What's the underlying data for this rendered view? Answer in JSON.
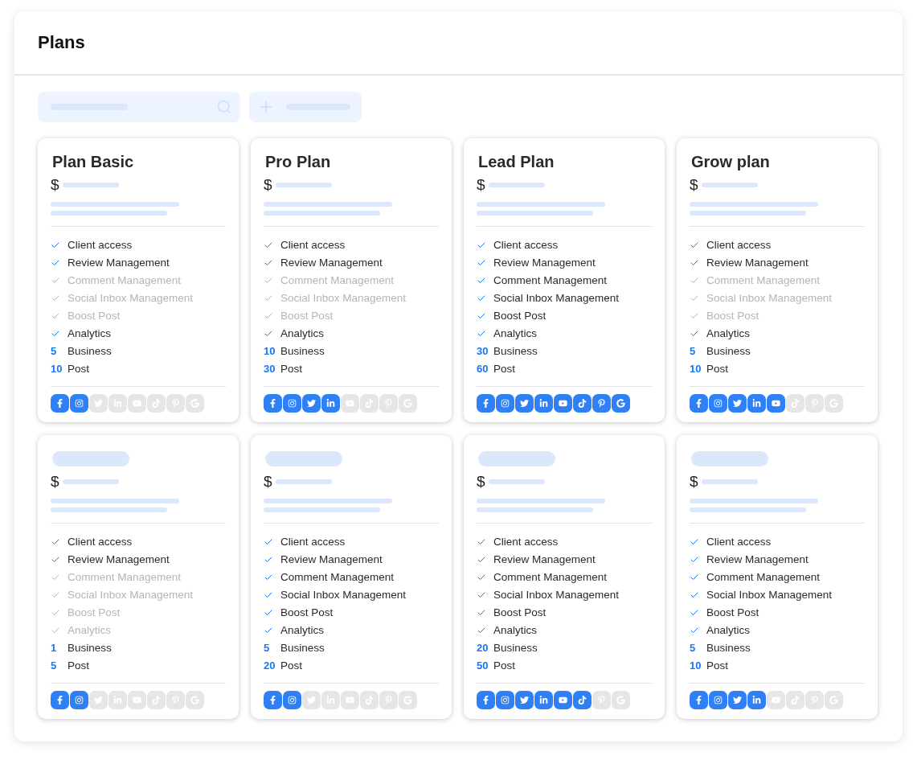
{
  "page": {
    "title": "Plans"
  },
  "cards": [
    {
      "title": "Plan Basic",
      "features": [
        {
          "kind": "check",
          "label": "Client access",
          "checked": true
        },
        {
          "kind": "check",
          "label": "Review Management",
          "checked": true
        },
        {
          "kind": "check",
          "label": "Comment Management",
          "checked": false
        },
        {
          "kind": "check",
          "label": "Social Inbox Management",
          "checked": false
        },
        {
          "kind": "check",
          "label": "Boost Post",
          "checked": false
        },
        {
          "kind": "check",
          "label": "Analytics",
          "checked": true
        },
        {
          "kind": "count",
          "amount": "5",
          "label": "Business"
        },
        {
          "kind": "count",
          "amount": "10",
          "label": "Post"
        }
      ],
      "socials": [
        {
          "kind": "facebook",
          "on": true
        },
        {
          "kind": "instagram",
          "on": true
        },
        {
          "kind": "twitter",
          "on": false
        },
        {
          "kind": "linkedin",
          "on": false
        },
        {
          "kind": "youtube",
          "on": false
        },
        {
          "kind": "tiktok",
          "on": false
        },
        {
          "kind": "pinterest",
          "on": false
        },
        {
          "kind": "google",
          "on": false
        }
      ]
    },
    {
      "title": "Pro Plan",
      "features": [
        {
          "kind": "check",
          "label": "Client access",
          "checked": true
        },
        {
          "kind": "check",
          "label": "Review Management",
          "checked": true
        },
        {
          "kind": "check",
          "label": "Comment Management",
          "checked": false
        },
        {
          "kind": "check",
          "label": "Social Inbox Management",
          "checked": false
        },
        {
          "kind": "check",
          "label": "Boost Post",
          "checked": false
        },
        {
          "kind": "check",
          "label": "Analytics",
          "checked": true
        },
        {
          "kind": "count",
          "amount": "10",
          "label": "Business"
        },
        {
          "kind": "count",
          "amount": "30",
          "label": "Post"
        }
      ],
      "socials": [
        {
          "kind": "facebook",
          "on": true
        },
        {
          "kind": "instagram",
          "on": true
        },
        {
          "kind": "twitter",
          "on": true
        },
        {
          "kind": "linkedin",
          "on": true
        },
        {
          "kind": "youtube",
          "on": false
        },
        {
          "kind": "tiktok",
          "on": false
        },
        {
          "kind": "pinterest",
          "on": false
        },
        {
          "kind": "google",
          "on": false
        }
      ]
    },
    {
      "title": "Lead Plan",
      "features": [
        {
          "kind": "check",
          "label": "Client access",
          "checked": true
        },
        {
          "kind": "check",
          "label": "Review Management",
          "checked": true
        },
        {
          "kind": "check",
          "label": "Comment Management",
          "checked": true
        },
        {
          "kind": "check",
          "label": "Social Inbox Management",
          "checked": true
        },
        {
          "kind": "check",
          "label": "Boost Post",
          "checked": true
        },
        {
          "kind": "check",
          "label": "Analytics",
          "checked": true
        },
        {
          "kind": "count",
          "amount": "30",
          "label": "Business"
        },
        {
          "kind": "count",
          "amount": "60",
          "label": "Post"
        }
      ],
      "socials": [
        {
          "kind": "facebook",
          "on": true
        },
        {
          "kind": "instagram",
          "on": true
        },
        {
          "kind": "twitter",
          "on": true
        },
        {
          "kind": "linkedin",
          "on": true
        },
        {
          "kind": "youtube",
          "on": true
        },
        {
          "kind": "tiktok",
          "on": true
        },
        {
          "kind": "pinterest",
          "on": true
        },
        {
          "kind": "google",
          "on": true
        }
      ]
    },
    {
      "title": "Grow plan",
      "features": [
        {
          "kind": "check",
          "label": "Client access",
          "checked": true
        },
        {
          "kind": "check",
          "label": "Review Management",
          "checked": true
        },
        {
          "kind": "check",
          "label": "Comment Management",
          "checked": false
        },
        {
          "kind": "check",
          "label": "Social Inbox Management",
          "checked": false
        },
        {
          "kind": "check",
          "label": "Boost Post",
          "checked": false
        },
        {
          "kind": "check",
          "label": "Analytics",
          "checked": true
        },
        {
          "kind": "count",
          "amount": "5",
          "label": "Business"
        },
        {
          "kind": "count",
          "amount": "10",
          "label": "Post"
        }
      ],
      "socials": [
        {
          "kind": "facebook",
          "on": true
        },
        {
          "kind": "instagram",
          "on": true
        },
        {
          "kind": "twitter",
          "on": true
        },
        {
          "kind": "linkedin",
          "on": true
        },
        {
          "kind": "youtube",
          "on": true
        },
        {
          "kind": "tiktok",
          "on": false
        },
        {
          "kind": "pinterest",
          "on": false
        },
        {
          "kind": "google",
          "on": false
        }
      ]
    },
    {
      "features": [
        {
          "kind": "check",
          "label": "Client access",
          "checked": true
        },
        {
          "kind": "check",
          "label": "Review Management",
          "checked": true
        },
        {
          "kind": "check",
          "label": "Comment Management",
          "checked": false
        },
        {
          "kind": "check",
          "label": "Social Inbox Management",
          "checked": false
        },
        {
          "kind": "check",
          "label": "Boost Post",
          "checked": false
        },
        {
          "kind": "check",
          "label": "Analytics",
          "checked": false
        },
        {
          "kind": "count",
          "amount": "1",
          "label": "Business"
        },
        {
          "kind": "count",
          "amount": "5",
          "label": "Post"
        }
      ],
      "socials": [
        {
          "kind": "facebook",
          "on": true
        },
        {
          "kind": "instagram",
          "on": true
        },
        {
          "kind": "twitter",
          "on": false
        },
        {
          "kind": "linkedin",
          "on": false
        },
        {
          "kind": "youtube",
          "on": false
        },
        {
          "kind": "tiktok",
          "on": false
        },
        {
          "kind": "pinterest",
          "on": false
        },
        {
          "kind": "google",
          "on": false
        }
      ]
    },
    {
      "features": [
        {
          "kind": "check",
          "label": "Client access",
          "checked": true
        },
        {
          "kind": "check",
          "label": "Review Management",
          "checked": true
        },
        {
          "kind": "check",
          "label": "Comment Management",
          "checked": true
        },
        {
          "kind": "check",
          "label": "Social Inbox Management",
          "checked": true
        },
        {
          "kind": "check",
          "label": "Boost Post",
          "checked": true
        },
        {
          "kind": "check",
          "label": "Analytics",
          "checked": true
        },
        {
          "kind": "count",
          "amount": "5",
          "label": "Business"
        },
        {
          "kind": "count",
          "amount": "20",
          "label": "Post"
        }
      ],
      "socials": [
        {
          "kind": "facebook",
          "on": true
        },
        {
          "kind": "instagram",
          "on": true
        },
        {
          "kind": "twitter",
          "on": false
        },
        {
          "kind": "linkedin",
          "on": false
        },
        {
          "kind": "youtube",
          "on": false
        },
        {
          "kind": "tiktok",
          "on": false
        },
        {
          "kind": "pinterest",
          "on": false
        },
        {
          "kind": "google",
          "on": false
        }
      ]
    },
    {
      "features": [
        {
          "kind": "check",
          "label": "Client access",
          "checked": true
        },
        {
          "kind": "check",
          "label": "Review Management",
          "checked": true
        },
        {
          "kind": "check",
          "label": "Comment Management",
          "checked": true
        },
        {
          "kind": "check",
          "label": "Social Inbox Management",
          "checked": true
        },
        {
          "kind": "check",
          "label": "Boost Post",
          "checked": true
        },
        {
          "kind": "check",
          "label": "Analytics",
          "checked": true
        },
        {
          "kind": "count",
          "amount": "20",
          "label": "Business"
        },
        {
          "kind": "count",
          "amount": "50",
          "label": "Post"
        }
      ],
      "socials": [
        {
          "kind": "facebook",
          "on": true
        },
        {
          "kind": "instagram",
          "on": true
        },
        {
          "kind": "twitter",
          "on": true
        },
        {
          "kind": "linkedin",
          "on": true
        },
        {
          "kind": "youtube",
          "on": true
        },
        {
          "kind": "tiktok",
          "on": true
        },
        {
          "kind": "pinterest",
          "on": false
        },
        {
          "kind": "google",
          "on": false
        }
      ]
    },
    {
      "features": [
        {
          "kind": "check",
          "label": "Client access",
          "checked": true
        },
        {
          "kind": "check",
          "label": "Review Management",
          "checked": true
        },
        {
          "kind": "check",
          "label": "Comment Management",
          "checked": true
        },
        {
          "kind": "check",
          "label": "Social Inbox Management",
          "checked": true
        },
        {
          "kind": "check",
          "label": "Boost Post",
          "checked": true
        },
        {
          "kind": "check",
          "label": "Analytics",
          "checked": true
        },
        {
          "kind": "count",
          "amount": "5",
          "label": "Business"
        },
        {
          "kind": "count",
          "amount": "10",
          "label": "Post"
        }
      ],
      "socials": [
        {
          "kind": "facebook",
          "on": true
        },
        {
          "kind": "instagram",
          "on": true
        },
        {
          "kind": "twitter",
          "on": true
        },
        {
          "kind": "linkedin",
          "on": true
        },
        {
          "kind": "youtube",
          "on": false
        },
        {
          "kind": "tiktok",
          "on": false
        },
        {
          "kind": "pinterest",
          "on": false
        },
        {
          "kind": "google",
          "on": false
        }
      ]
    }
  ],
  "currency": "$"
}
